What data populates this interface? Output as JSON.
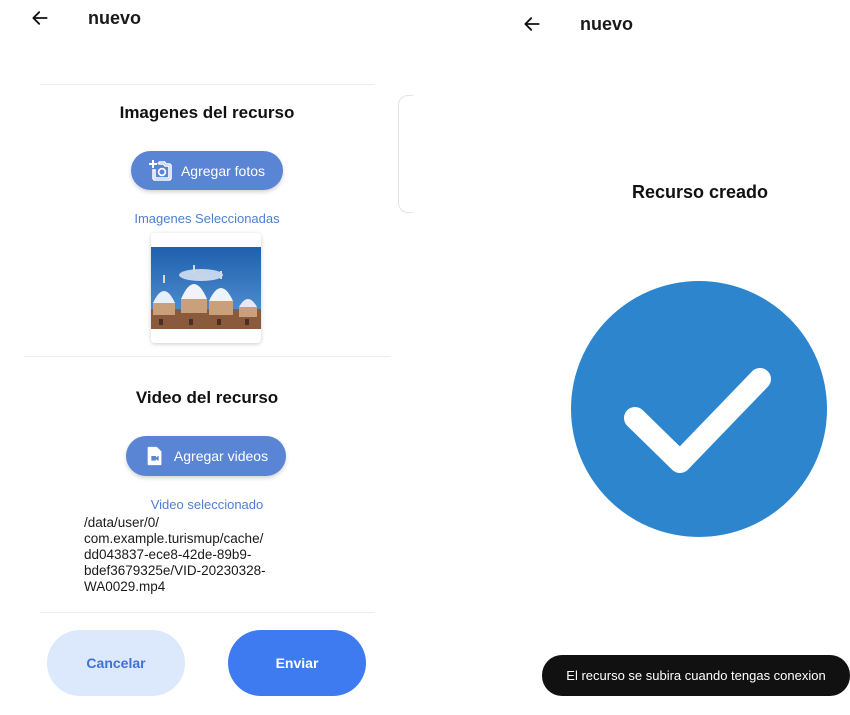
{
  "left": {
    "appbar": {
      "title": "nuevo"
    },
    "images": {
      "title": "Imagenes del recurso",
      "add_button": "Agregar fotos",
      "selected_label": "Imagenes Seleccionadas"
    },
    "video": {
      "title": "Video del recurso",
      "add_button": "Agregar videos",
      "selected_label": "Video seleccionado",
      "path_lines": [
        "/data/user/0/",
        "com.example.turismup/cache/",
        "dd043837-ece8-42de-89b9-",
        "bdef3679325e/VID-20230328-",
        "WA0029.mp4"
      ]
    },
    "actions": {
      "cancel": "Cancelar",
      "send": "Enviar"
    }
  },
  "right": {
    "appbar": {
      "title": "nuevo"
    },
    "status_title": "Recurso creado",
    "toast": "El recurso se subira cuando tengas conexion"
  },
  "colors": {
    "accent": "#5a84d4",
    "send": "#3f7bf0",
    "cancel_bg": "#dce8fb",
    "cancel_text": "#3d72d6",
    "success_circle": "#2d86cd"
  },
  "icons": {
    "back": "arrow-left-icon",
    "add_photo": "add-photo-camera-icon",
    "add_video": "video-file-icon",
    "success": "check-circle-icon"
  }
}
